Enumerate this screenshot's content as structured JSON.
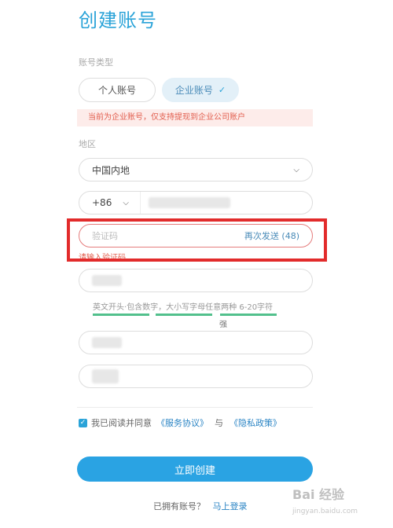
{
  "title": "创建账号",
  "account_type": {
    "label": "账号类型",
    "personal": "个人账号",
    "company": "企业账号",
    "company_check": "✓",
    "notice": "当前为企业账号，仅支持提现到企业公司账户"
  },
  "region": {
    "label": "地区",
    "value": "中国内地"
  },
  "phone": {
    "country_code": "+86"
  },
  "verification": {
    "placeholder": "验证码",
    "resend": "再次发送 (48)",
    "error": "请输入验证码"
  },
  "password": {
    "hint": "英文开头·包含数字，大小写字母任意两种 6-20字符",
    "strength": 0.8,
    "strength_label": "强"
  },
  "agreement": {
    "checked": true,
    "prefix": "我已阅读并同意",
    "terms": "《服务协议》",
    "and": "与",
    "privacy": "《隐私政策》"
  },
  "submit_label": "立即创建",
  "login": {
    "prompt": "已拥有账号？",
    "link": "马上登录"
  },
  "watermark": {
    "main": "Bai 经验",
    "sub": "jingyan.baidu.com"
  },
  "colors": {
    "accent": "#2aa3e3",
    "error": "#e25d4d",
    "highlight": "#e22b2b",
    "strength": "#52c08c"
  }
}
